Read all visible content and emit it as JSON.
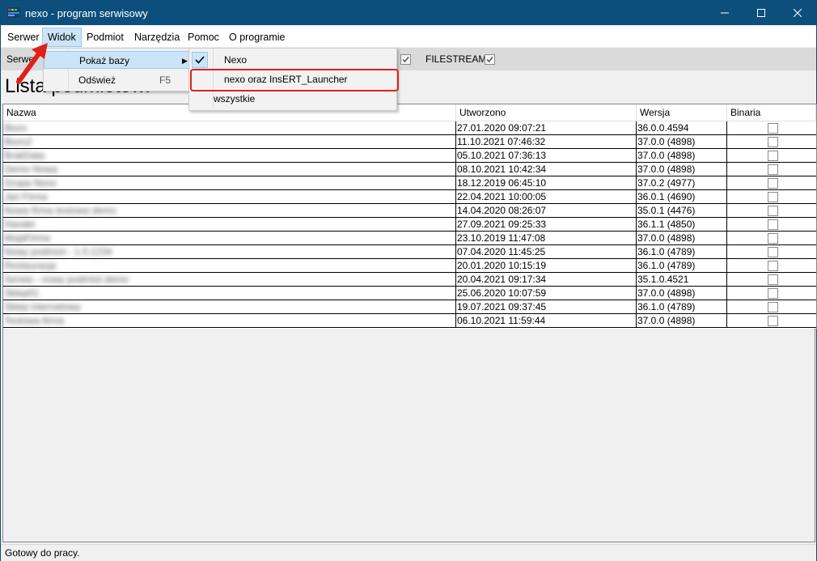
{
  "window": {
    "title": "nexo - program serwisowy",
    "app_icon": "insert-nexo-app-icon",
    "title_bar_color": "#0d4f7c"
  },
  "window_controls": {
    "minimize_icon": "minimize-icon",
    "maximize_icon": "maximize-icon",
    "close_icon": "close-icon"
  },
  "menu": {
    "items": [
      {
        "label": "Serwer"
      },
      {
        "label": "Widok"
      },
      {
        "label": "Podmiot"
      },
      {
        "label": "Narzędzia"
      },
      {
        "label": "Pomoc"
      },
      {
        "label": "O programie"
      }
    ]
  },
  "toolbar": {
    "server_label_partial": "Serwer",
    "filestream_label": "FILESTREAM:",
    "filestream_checked": true,
    "other_checked": true
  },
  "page": {
    "title": "Lista podmiotów:"
  },
  "widok_menu": {
    "items": [
      {
        "label": "Pokaż bazy",
        "has_submenu": true
      },
      {
        "label": "Odśwież",
        "shortcut": "F5"
      }
    ]
  },
  "bazy_submenu": {
    "items": [
      {
        "label": "Nexo",
        "checked": true
      },
      {
        "label": "nexo oraz InsERT_Launcher",
        "checked": false
      },
      {
        "label": "wszystkie",
        "checked": false
      }
    ]
  },
  "annotation": {
    "color": "#e0201a"
  },
  "grid": {
    "columns": [
      "Nazwa",
      "Utworzono",
      "Wersja",
      "Binaria"
    ],
    "rows": [
      {
        "nazwa": "Biuro",
        "utworzono": "27.01.2020 09:07:21",
        "wersja": "36.0.0.4594",
        "binaria": false
      },
      {
        "nazwa": "Biuro2",
        "utworzono": "11.10.2021 07:46:32",
        "wersja": "37.0.0 (4898)",
        "binaria": false
      },
      {
        "nazwa": "BrakData",
        "utworzono": "05.10.2021 07:36:13",
        "wersja": "37.0.0 (4898)",
        "binaria": false
      },
      {
        "nazwa": "Demo Nowa",
        "utworzono": "08.10.2021 10:42:34",
        "wersja": "37.0.0 (4898)",
        "binaria": false
      },
      {
        "nazwa": "Grupa Nexo",
        "utworzono": "18.12.2019 06:45:10",
        "wersja": "37.0.2 (4977)",
        "binaria": false
      },
      {
        "nazwa": "Jan Firma",
        "utworzono": "22.04.2021 10:00:05",
        "wersja": "36.0.1 (4690)",
        "binaria": false
      },
      {
        "nazwa": "Nowa firma testowa demo",
        "utworzono": "14.04.2020 08:26:07",
        "wersja": "35.0.1 (4476)",
        "binaria": false
      },
      {
        "nazwa": "Handel",
        "utworzono": "27.09.2021 09:25:33",
        "wersja": "36.1.1 (4850)",
        "binaria": false
      },
      {
        "nazwa": "MojaFirma",
        "utworzono": "23.10.2019 11:47:08",
        "wersja": "37.0.0 (4898)",
        "binaria": false
      },
      {
        "nazwa": "Nowy podmiot - 1.0.1234",
        "utworzono": "07.04.2020 11:45:25",
        "wersja": "36.1.0 (4789)",
        "binaria": false
      },
      {
        "nazwa": "Restauracja",
        "utworzono": "20.01.2020 10:15:19",
        "wersja": "36.1.0 (4789)",
        "binaria": false
      },
      {
        "nazwa": "Serwis - nowy podmiot demo",
        "utworzono": "20.04.2021 09:17:34",
        "wersja": "35.1.0.4521",
        "binaria": false
      },
      {
        "nazwa": "Sklep01",
        "utworzono": "25.06.2020 10:07:59",
        "wersja": "37.0.0 (4898)",
        "binaria": false
      },
      {
        "nazwa": "Sklep internetowy",
        "utworzono": "19.07.2021 09:37:45",
        "wersja": "36.1.0 (4789)",
        "binaria": false
      },
      {
        "nazwa": "Testowa firma",
        "utworzono": "06.10.2021 11:59:44",
        "wersja": "37.0.0 (4898)",
        "binaria": false
      }
    ]
  },
  "status": {
    "text": "Gotowy do pracy."
  }
}
